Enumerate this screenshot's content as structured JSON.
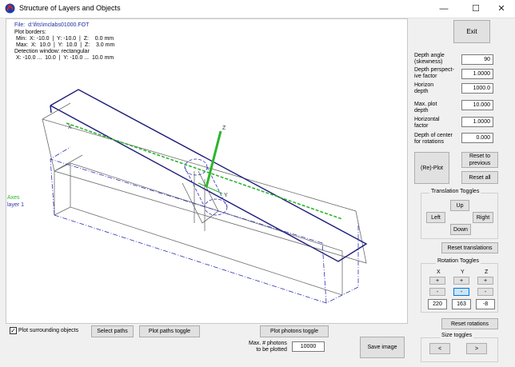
{
  "window": {
    "title": "Structure of Layers and Objects",
    "minimize": "—",
    "maximize": "☐",
    "close": "✕"
  },
  "info": {
    "file": "File:  d:\\fits\\mclabs01000.FOT",
    "plot_borders_label": "Plot borders:",
    "min_line": " Min:  X: -10.0  |  Y: -10.0  |  Z:    0.0 mm",
    "max_line": " Max:  X:  10.0  |  Y:  10.0  |  Z:    3.0 mm",
    "detection_line": "Detection window: rectangular",
    "detection_range": " X: -10.0 ...  10.0  |  Y: -10.0 ...  10.0 mm"
  },
  "legend": {
    "axes": "Axes",
    "layer": "layer 1"
  },
  "colors": {
    "axes_green": "#2db52d",
    "layer_blue": "#3030b8",
    "box_dark": "#1a1a7a",
    "grey": "#6b6b6b"
  },
  "right_panel": {
    "exit": "Exit",
    "depth_angle_label": "Depth angle\n(skewness)",
    "depth_angle_value": "90",
    "depth_persp_label": "Depth perspect-\nive factor",
    "depth_persp_value": "1.0000",
    "horizon_label": "Horizon\ndepth",
    "horizon_value": "1000.0",
    "max_plot_label": "Max. plot\ndepth",
    "max_plot_value": "10.000",
    "horizontal_label": "Horizontal\nfactor",
    "horizontal_value": "1.0000",
    "depth_center_label": "Depth of center\nfor rotations",
    "depth_center_value": "0.000",
    "replot": "(Re)-Plot",
    "reset_previous": "Reset to\nprevious",
    "reset_all": "Reset all",
    "translation_title": "Translation Toggles",
    "up": "Up",
    "left": "Left",
    "right": "Right",
    "down": "Down",
    "reset_translations": "Reset translations",
    "rotation_title": "Rotation Toggles",
    "x": "X",
    "y": "Y",
    "z": "Z",
    "plus": "+",
    "minus": "-",
    "rot_x": "220",
    "rot_y": "163",
    "rot_z": "-8",
    "reset_rotations": "Reset rotations",
    "size_title": "Size toggles",
    "size_less": "<",
    "size_more": ">"
  },
  "bottom": {
    "plot_surrounding": "Plot surrounding objects",
    "select_paths": "Select paths",
    "plot_paths_toggle": "Plot paths toggle",
    "plot_photons_toggle": "Plot photons toggle",
    "max_photons_label": "Max. # photons\nto be plotted",
    "max_photons_value": "10000",
    "save_image": "Save image"
  },
  "axis_labels": {
    "x": "X",
    "y": "Y",
    "z": "Z"
  }
}
